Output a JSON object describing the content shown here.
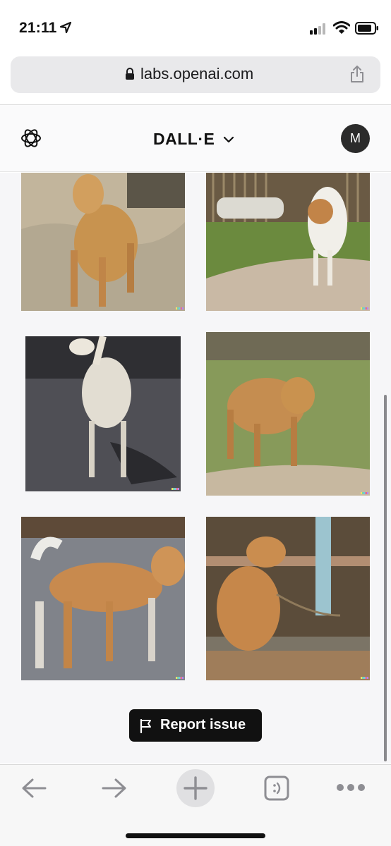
{
  "status_bar": {
    "time": "21:11",
    "icons": [
      "location-arrow-icon",
      "cellular-signal-icon",
      "wifi-icon",
      "battery-icon"
    ]
  },
  "browser": {
    "url": "labs.openai.com",
    "icons": [
      "lock-icon",
      "share-icon"
    ]
  },
  "header": {
    "logo": "openai-logo-icon",
    "title": "DALL·E",
    "dropdown_icon": "chevron-down-icon",
    "avatar_initial": "M"
  },
  "gallery": {
    "images": [
      {
        "name": "dog-image-1",
        "bg": "#b79b74"
      },
      {
        "name": "dog-image-2",
        "bg": "#8a9a5c"
      },
      {
        "name": "dog-image-3",
        "bg": "#535359"
      },
      {
        "name": "dog-image-4",
        "bg": "#8c9b62"
      },
      {
        "name": "dog-image-5",
        "bg": "#7f8288"
      },
      {
        "name": "dog-image-6",
        "bg": "#6b5a45"
      }
    ]
  },
  "report_button": {
    "icon": "flag-icon",
    "label": "Report issue"
  },
  "toolbar": {
    "items": [
      "back-arrow-icon",
      "forward-arrow-icon",
      "new-tab-plus-icon",
      "tabs-icon",
      "more-icon"
    ]
  },
  "colors": {
    "accent": "#111111",
    "background": "#f6f6f8",
    "toolbar_icon": "#8e8e93"
  }
}
